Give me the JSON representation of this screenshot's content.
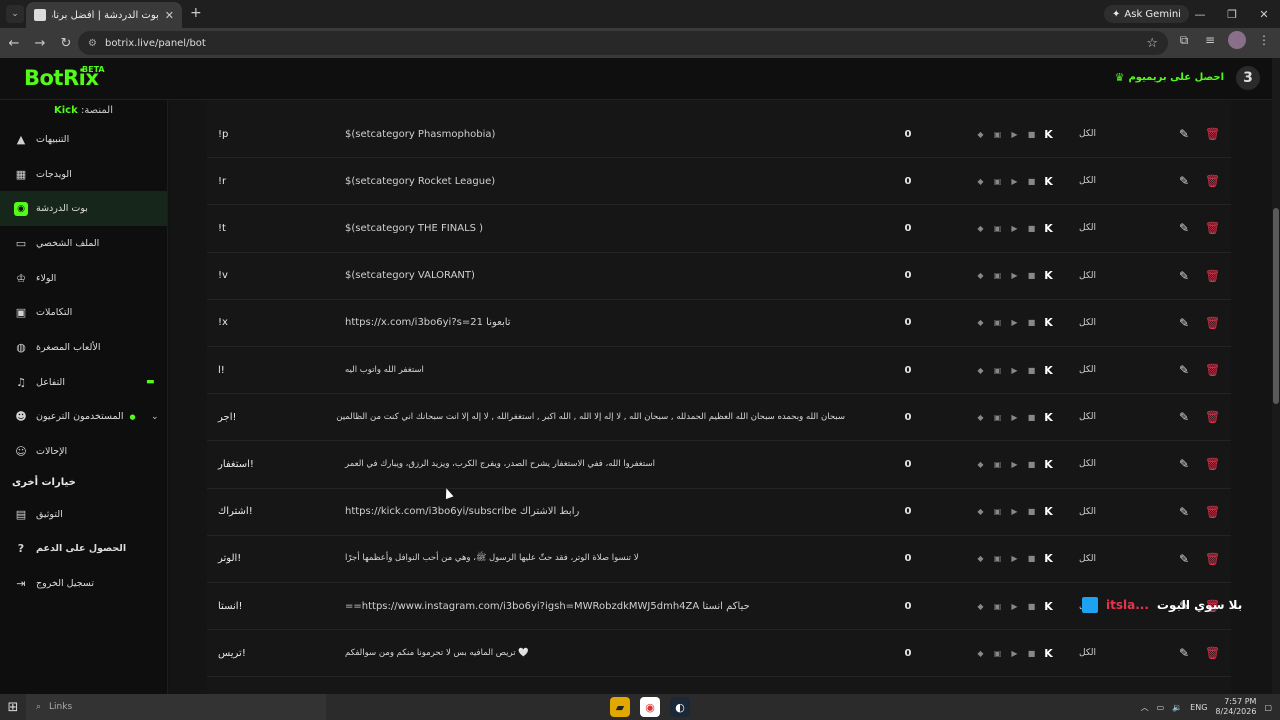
{
  "browser": {
    "tab_title": "بوت الدردشة | أفضل برنامج لتعز",
    "url": "botrix.live/panel/bot",
    "ask_gemini": "Ask Gemini"
  },
  "header": {
    "logo": "BotRix",
    "beta": "BETA",
    "premium": "احصل على بريميوم",
    "avatar_letter": "3"
  },
  "sidebar": {
    "platform_label": "المنصة:",
    "platform_value": "Kick",
    "items": [
      {
        "label": "التنبيهات",
        "icon": "warning-icon"
      },
      {
        "label": "الويدجات",
        "icon": "widgets-icon"
      },
      {
        "label": "بوت الدردشة",
        "icon": "robot-icon"
      },
      {
        "label": "الملف الشخصي",
        "icon": "profile-icon"
      },
      {
        "label": "الولاء",
        "icon": "trophy-icon"
      },
      {
        "label": "التكاملات",
        "icon": "integrations-icon"
      },
      {
        "label": "الألعاب المصغرة",
        "icon": "gamepad-icon"
      },
      {
        "label": "التفاعل",
        "icon": "music-icon"
      },
      {
        "label": "المستخدمون الترعيون",
        "icon": "users-icon"
      },
      {
        "label": "الإحالات",
        "icon": "referrals-icon"
      }
    ],
    "other_title": "خيارات أخرى",
    "other_items": [
      {
        "label": "التوثيق",
        "icon": "docs-icon"
      },
      {
        "label": "الحصول على الدعم",
        "icon": "help-icon"
      },
      {
        "label": "تسجيل الخروج",
        "icon": "logout-icon"
      }
    ]
  },
  "commands": [
    {
      "cmd": "!p",
      "response": "$(setcategory Phasmophobia)",
      "count": "0",
      "perm": "الكل"
    },
    {
      "cmd": "!r",
      "response": "$(setcategory Rocket League)",
      "count": "0",
      "perm": "الكل"
    },
    {
      "cmd": "!t",
      "response": "$(setcategory THE FINALS )",
      "count": "0",
      "perm": "الكل"
    },
    {
      "cmd": "!v",
      "response": "$(setcategory VALORANT)",
      "count": "0",
      "perm": "الكل"
    },
    {
      "cmd": "!x",
      "response": "تابعونا https://x.com/i3bo6yi?s=21",
      "count": "0",
      "perm": "الكل"
    },
    {
      "cmd": "!ا",
      "response": "استغفر الله واتوب اليه",
      "count": "0",
      "perm": "الكل"
    },
    {
      "cmd": "!اجر",
      "response": "سبحان الله وبحمده سبحان الله العظيم الحمدلله , سبحان الله , لا إله إلا الله , الله اكبر , استغفرالله , لا إله إلا انت سبحانك اني كنت من الظالمين",
      "count": "0",
      "perm": "الكل"
    },
    {
      "cmd": "!استغفار",
      "response": "استغفروا الله، ففي الاستغفار يشرح الصدر، ويفرج الكرب، ويزيد الرزق، ويبارك في العمر",
      "count": "0",
      "perm": "الكل"
    },
    {
      "cmd": "!اشتراك",
      "response": "رابط الاشتراك https://kick.com/i3bo6yi/subscribe",
      "count": "0",
      "perm": "الكل"
    },
    {
      "cmd": "!الوتر",
      "response": "لا تنسوا صلاة الوتر، فقد حثّ عليها الرسول ﷺ، وهي من أحب النوافل وأعظمها أجرًا",
      "count": "0",
      "perm": "الكل"
    },
    {
      "cmd": "!انستا",
      "response": "حياكم انستا https://www.instagram.com/i3bo6yi?igsh=MWRobzdkMWJ5dmh4ZA==",
      "count": "0",
      "perm": "الكل"
    },
    {
      "cmd": "!تريس",
      "response": "🤍 تريص المافيه بس لا تحرمونا منكم ومن سوالفكم",
      "count": "0",
      "perm": "الكل"
    }
  ],
  "overlay": {
    "brand": "itsla...",
    "text": "بلا سوي البوت"
  },
  "taskbar": {
    "search": "Links",
    "lang": "ENG",
    "time": "7:57 PM",
    "date": "8/24/2026"
  }
}
